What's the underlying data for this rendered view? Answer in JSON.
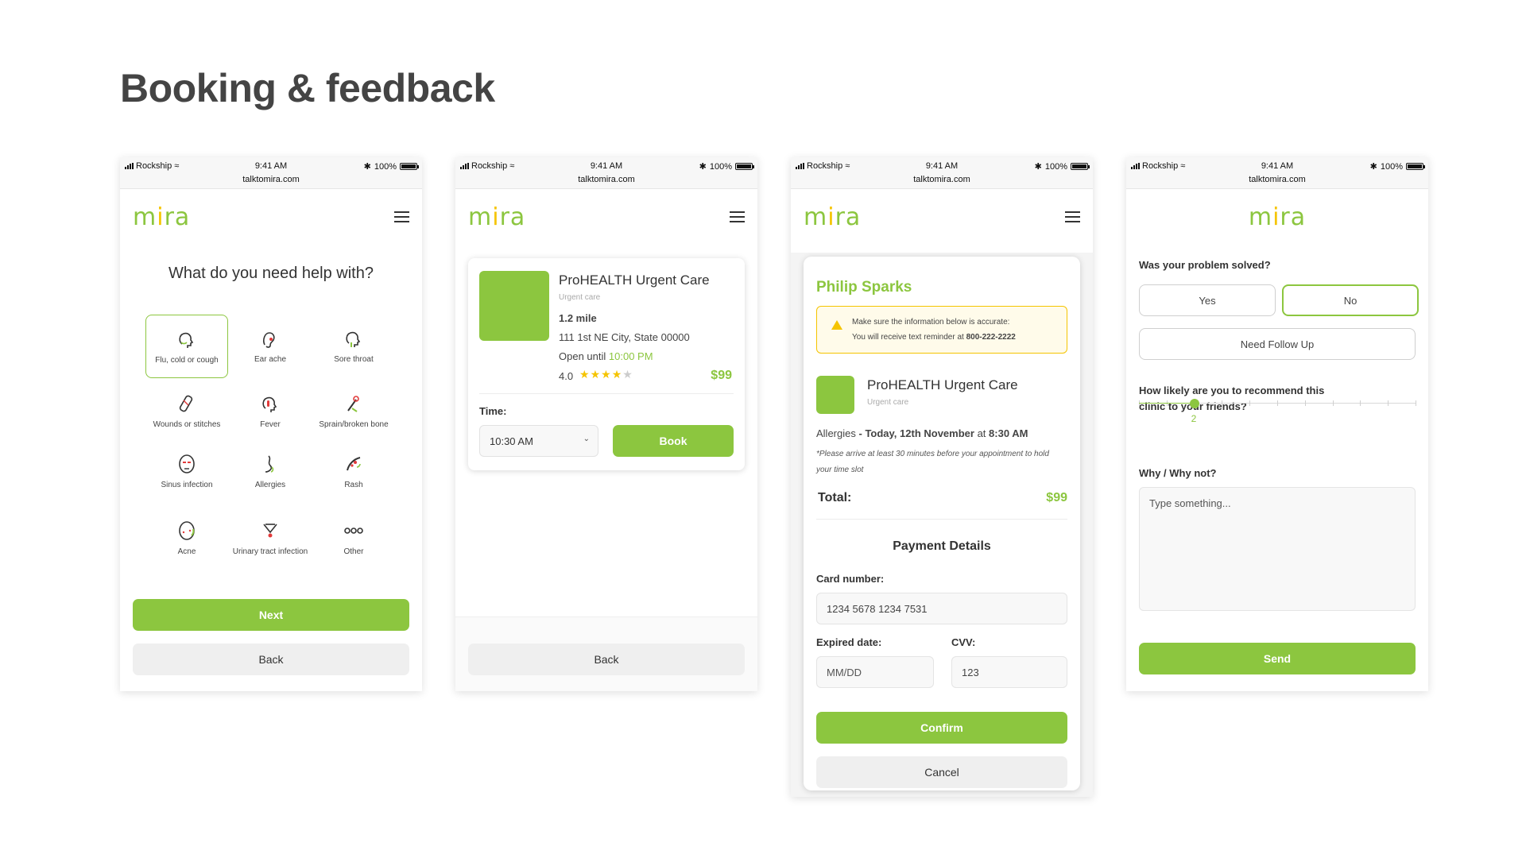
{
  "page": {
    "title": "Booking & feedback"
  },
  "status_bar": {
    "carrier": "Rockship",
    "time": "9:41 AM",
    "battery": "100%",
    "url": "talktomira.com"
  },
  "brand": {
    "logo_pre": "m",
    "logo_dot": "i",
    "logo_post": "ra",
    "accent": "#8cc63f",
    "highlight": "#f5c400"
  },
  "screen1": {
    "question": "What do you need help with?",
    "symptoms": [
      {
        "label": "Flu, cold or cough",
        "icon": "head-icon",
        "selected": true
      },
      {
        "label": "Ear ache",
        "icon": "ear-icon",
        "selected": false
      },
      {
        "label": "Sore throat",
        "icon": "throat-icon",
        "selected": false
      },
      {
        "label": "Wounds or stitches",
        "icon": "bandage-icon",
        "selected": false
      },
      {
        "label": "Fever",
        "icon": "thermometer-head-icon",
        "selected": false
      },
      {
        "label": "Sprain/broken bone",
        "icon": "bone-icon",
        "selected": false
      },
      {
        "label": "Sinus infection",
        "icon": "sinus-face-icon",
        "selected": false
      },
      {
        "label": "Allergies",
        "icon": "allergy-icon",
        "selected": false
      },
      {
        "label": "Rash",
        "icon": "rash-arm-icon",
        "selected": false
      },
      {
        "label": "Acne",
        "icon": "acne-face-icon",
        "selected": false
      },
      {
        "label": "Urinary tract infection",
        "icon": "urinary-icon",
        "selected": false
      },
      {
        "label": "Other",
        "icon": "more-dots-icon",
        "selected": false
      }
    ],
    "next_label": "Next",
    "back_label": "Back"
  },
  "screen2": {
    "clinic_name": "ProHEALTH Urgent Care",
    "clinic_type": "Urgent care",
    "distance": "1.2 mile",
    "address": "111 1st NE City, State 00000",
    "open_prefix": "Open until",
    "open_time": "10:00 PM",
    "rating": "4.0",
    "rating_value": 4,
    "rating_max": 5,
    "price": "$99",
    "time_label": "Time:",
    "time_value": "10:30 AM",
    "book_label": "Book",
    "back_label": "Back"
  },
  "screen3": {
    "patient_name": "Philip Sparks",
    "notice_line1": "Make sure the information below is accurate:",
    "notice_line2_prefix": "You will receive text reminder at",
    "notice_phone": "800-222-2222",
    "clinic_name": "ProHEALTH Urgent Care",
    "clinic_type": "Urgent care",
    "reason": "Allergies",
    "separator": "-",
    "date": "Today, 12th November",
    "at_word": "at",
    "time": "8:30 AM",
    "arrival_note_line1": "*Please arrive at least 30 minutes before your appointment to hold",
    "arrival_note_line2": "your time slot",
    "total_label": "Total:",
    "total_value": "$99",
    "payment_title": "Payment Details",
    "card_label": "Card number:",
    "card_value": "1234 5678 1234 7531",
    "exp_label": "Expired date:",
    "exp_placeholder": "MM/DD",
    "cvv_label": "CVV:",
    "cvv_value": "123",
    "confirm_label": "Confirm",
    "cancel_label": "Cancel"
  },
  "screen4": {
    "solved_question": "Was your problem solved?",
    "yes_label": "Yes",
    "no_label": "No",
    "followup_label": "Need Follow Up",
    "selected_answer": "No",
    "recommend_line1": "How likely are you to recommend this",
    "recommend_line2": "clinic to your friends?",
    "recommend_value": 2,
    "recommend_max": 10,
    "recommend_value_text": "2",
    "why_label": "Why / Why not?",
    "why_placeholder": "Type something...",
    "send_label": "Send"
  }
}
